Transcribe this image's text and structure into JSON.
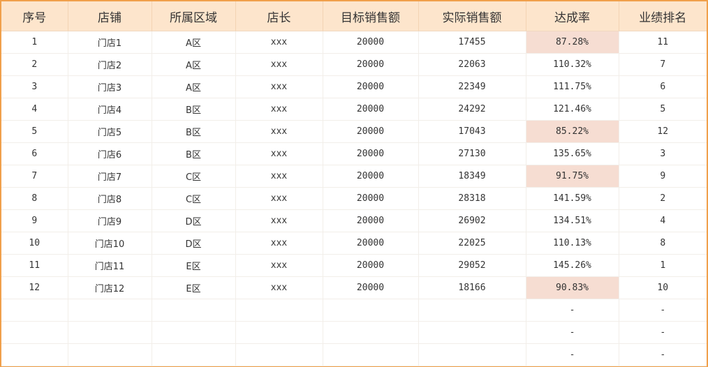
{
  "table": {
    "headers": [
      "序号",
      "店铺",
      "所属区域",
      "店长",
      "目标销售额",
      "实际销售额",
      "达成率",
      "业绩排名"
    ],
    "rows": [
      {
        "no": "1",
        "store": "门店1",
        "region": "A区",
        "manager": "xxx",
        "target": "20000",
        "actual": "17455",
        "rate": "87.28%",
        "rank": "11",
        "below_target": true
      },
      {
        "no": "2",
        "store": "门店2",
        "region": "A区",
        "manager": "xxx",
        "target": "20000",
        "actual": "22063",
        "rate": "110.32%",
        "rank": "7",
        "below_target": false
      },
      {
        "no": "3",
        "store": "门店3",
        "region": "A区",
        "manager": "xxx",
        "target": "20000",
        "actual": "22349",
        "rate": "111.75%",
        "rank": "6",
        "below_target": false
      },
      {
        "no": "4",
        "store": "门店4",
        "region": "B区",
        "manager": "xxx",
        "target": "20000",
        "actual": "24292",
        "rate": "121.46%",
        "rank": "5",
        "below_target": false
      },
      {
        "no": "5",
        "store": "门店5",
        "region": "B区",
        "manager": "xxx",
        "target": "20000",
        "actual": "17043",
        "rate": "85.22%",
        "rank": "12",
        "below_target": true
      },
      {
        "no": "6",
        "store": "门店6",
        "region": "B区",
        "manager": "xxx",
        "target": "20000",
        "actual": "27130",
        "rate": "135.65%",
        "rank": "3",
        "below_target": false
      },
      {
        "no": "7",
        "store": "门店7",
        "region": "C区",
        "manager": "xxx",
        "target": "20000",
        "actual": "18349",
        "rate": "91.75%",
        "rank": "9",
        "below_target": true
      },
      {
        "no": "8",
        "store": "门店8",
        "region": "C区",
        "manager": "xxx",
        "target": "20000",
        "actual": "28318",
        "rate": "141.59%",
        "rank": "2",
        "below_target": false
      },
      {
        "no": "9",
        "store": "门店9",
        "region": "D区",
        "manager": "xxx",
        "target": "20000",
        "actual": "26902",
        "rate": "134.51%",
        "rank": "4",
        "below_target": false
      },
      {
        "no": "10",
        "store": "门店10",
        "region": "D区",
        "manager": "xxx",
        "target": "20000",
        "actual": "22025",
        "rate": "110.13%",
        "rank": "8",
        "below_target": false
      },
      {
        "no": "11",
        "store": "门店11",
        "region": "E区",
        "manager": "xxx",
        "target": "20000",
        "actual": "29052",
        "rate": "145.26%",
        "rank": "1",
        "below_target": false
      },
      {
        "no": "12",
        "store": "门店12",
        "region": "E区",
        "manager": "xxx",
        "target": "20000",
        "actual": "18166",
        "rate": "90.83%",
        "rank": "10",
        "below_target": true
      }
    ],
    "empty_rows": [
      {
        "rate": "-",
        "rank": "-"
      },
      {
        "rate": "-",
        "rank": "-"
      },
      {
        "rate": "-",
        "rank": "-"
      }
    ]
  },
  "colors": {
    "frame_border": "#f0a04b",
    "header_background": "#fde5cc",
    "below_target_highlight": "#f6ddd2"
  }
}
